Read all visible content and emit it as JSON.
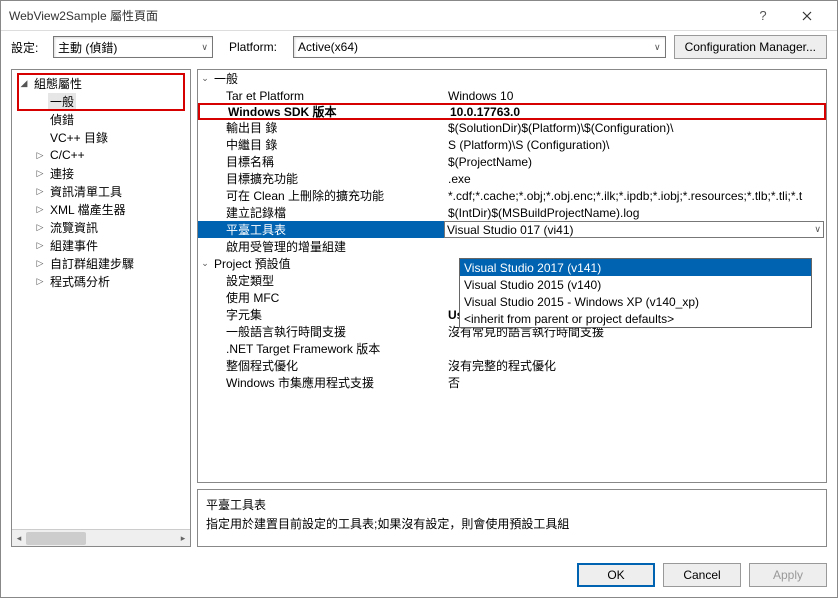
{
  "title": "WebView2Sample 屬性頁面",
  "toolbar": {
    "setting_label": "設定:",
    "setting_value": "主動 (偵錯)",
    "platform_label": "Platform:",
    "platform_value": "Active(x64)",
    "config_mgr": "Configuration Manager..."
  },
  "tree": [
    {
      "label": "組態屬性",
      "expand": "▢",
      "lv": 1,
      "tw": "◢"
    },
    {
      "label": "一般",
      "lv": 2,
      "sel": true
    },
    {
      "label": "偵錯",
      "lv": 2
    },
    {
      "label": "VC++ 目錄",
      "lv": 2
    },
    {
      "label": "C/C++",
      "lv": 2,
      "tw": "▷"
    },
    {
      "label": "連接",
      "lv": 2,
      "tw": "▷"
    },
    {
      "label": "資訊清單工具",
      "lv": 2,
      "tw": "▷"
    },
    {
      "label": "XML 檔產生器",
      "lv": 2,
      "tw": "▷"
    },
    {
      "label": "流覽資訊",
      "lv": 2,
      "tw": "▷"
    },
    {
      "label": "組建事件",
      "lv": 2,
      "tw": "▷"
    },
    {
      "label": "自訂群組建步驟",
      "lv": 2,
      "tw": "▷"
    },
    {
      "label": "程式碼分析",
      "lv": 2,
      "tw": "▷"
    }
  ],
  "grid": {
    "section1": "一般",
    "rows1": [
      {
        "k": "Tar et Platform",
        "v": "Windows 10"
      },
      {
        "k": "Windows SDK 版本",
        "v": "10.0.17763.0",
        "hl": true
      },
      {
        "k": "輸出目 錄",
        "v": "$(SolutionDir)$(Platform)\\$(Configuration)\\"
      },
      {
        "k": "中繼目 錄",
        "v": "S (Platform)\\S (Configuration)\\"
      },
      {
        "k": "目標名稱",
        "v": "$(ProjectName)"
      },
      {
        "k": "目標擴充功能",
        "v": ".exe"
      },
      {
        "k": "可在 Clean 上刪除的擴充功能",
        "v": "*.cdf;*.cache;*.obj;*.obj.enc;*.ilk;*.ipdb;*.iobj;*.resources;*.tlb;*.tli;*.t"
      },
      {
        "k": "建立記錄檔",
        "v": "$(IntDir)$(MSBuildProjectName).log"
      },
      {
        "k": "平臺工具表",
        "v": "Visual Studio 017 (vi41)",
        "sel": true
      },
      {
        "k": "啟用受管理的增量組建",
        "v": ""
      }
    ],
    "section2": "Project 預設值",
    "rows2": [
      {
        "k": "設定類型",
        "v": ""
      },
      {
        "k": "使用 MFC",
        "v": ""
      },
      {
        "k": "字元集",
        "v": "Use Unicode Character Set",
        "bold": true
      },
      {
        "k": "一般語言執行時間支援",
        "v": "沒有常見的語言執行時間支援"
      },
      {
        "k": ".NET Target Framework 版本",
        "v": ""
      },
      {
        "k": "整個程式優化",
        "v": "沒有完整的程式優化"
      },
      {
        "k": "Windows 市集應用程式支援",
        "v": "否"
      }
    ]
  },
  "dropdown": {
    "options": [
      {
        "label": "Visual Studio 2017 (v141)",
        "sel": true
      },
      {
        "label": "Visual Studio 2015 (v140)"
      },
      {
        "label": "Visual Studio 2015 - Windows XP (v140_xp)"
      },
      {
        "label": "<inherit from parent or project defaults>"
      }
    ]
  },
  "desc": {
    "title": "平臺工具表",
    "text": "指定用於建置目前設定的工具表;如果沒有設定，則會使用預設工具組"
  },
  "footer": {
    "ok": "OK",
    "cancel": "Cancel",
    "apply": "Apply"
  }
}
